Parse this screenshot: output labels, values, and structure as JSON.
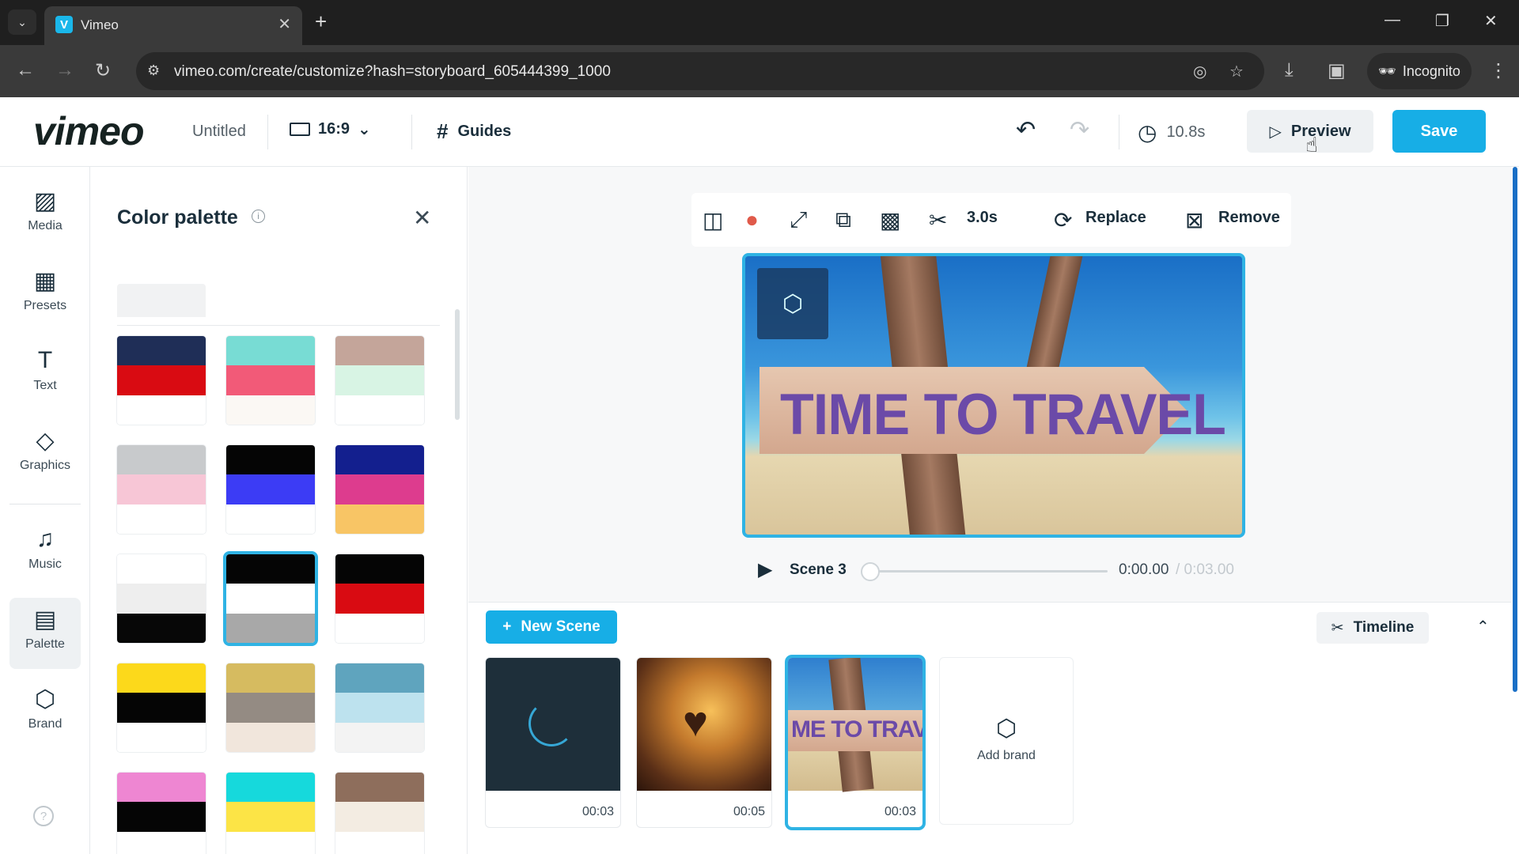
{
  "browser": {
    "tab_title": "Vimeo",
    "tab_favicon": "V",
    "url": "vimeo.com/create/customize?hash=storyboard_605444399_1000",
    "incognito_label": "Incognito"
  },
  "header": {
    "logo": "vimeo",
    "project_title": "Untitled",
    "aspect_ratio": "16:9",
    "guides_label": "Guides",
    "duration": "10.8s",
    "preview_label": "Preview",
    "save_label": "Save"
  },
  "rail": {
    "items": [
      {
        "label": "Media",
        "icon": "image-icon"
      },
      {
        "label": "Presets",
        "icon": "grid-icon"
      },
      {
        "label": "Text",
        "icon": "text-icon"
      },
      {
        "label": "Graphics",
        "icon": "shapes-icon"
      },
      {
        "label": "Music",
        "icon": "music-icon"
      },
      {
        "label": "Palette",
        "icon": "palette-icon"
      },
      {
        "label": "Brand",
        "icon": "brand-icon"
      }
    ],
    "active": "Palette"
  },
  "palette_panel": {
    "title": "Color palette",
    "palettes": [
      {
        "colors": [
          "#1f2e57",
          "#d90b12",
          "#ffffff"
        ]
      },
      {
        "colors": [
          "#78dcd4",
          "#f25a78",
          "#fbf8f4"
        ]
      },
      {
        "colors": [
          "#c4a59a",
          "#d8f4e4",
          "#ffffff"
        ]
      },
      {
        "colors": [
          "#c8cacc",
          "#f7c6d6",
          "#ffffff"
        ]
      },
      {
        "colors": [
          "#050505",
          "#3c3cf5",
          "#ffffff"
        ]
      },
      {
        "colors": [
          "#131f8e",
          "#dd3c8e",
          "#f8c565"
        ]
      },
      {
        "colors": [
          "#ffffff",
          "#eeeeee",
          "#070707"
        ]
      },
      {
        "colors": [
          "#050505",
          "#ffffff",
          "#a8a8a8"
        ],
        "selected": true
      },
      {
        "colors": [
          "#050505",
          "#d90b12",
          "#ffffff"
        ]
      },
      {
        "colors": [
          "#fcd91b",
          "#050505",
          "#ffffff"
        ]
      },
      {
        "colors": [
          "#d6bb60",
          "#948b83",
          "#f1e6dc"
        ]
      },
      {
        "colors": [
          "#5fa4be",
          "#bde2ee",
          "#f3f3f3"
        ]
      },
      {
        "colors": [
          "#ee86d2",
          "#050505",
          "#ffffff"
        ]
      },
      {
        "colors": [
          "#16d9dc",
          "#fce446",
          "#ffffff"
        ]
      },
      {
        "colors": [
          "#8e6e5c",
          "#f3ece2",
          "#ffffff"
        ]
      }
    ]
  },
  "toolbar": {
    "trim_duration": "3.0s",
    "replace_label": "Replace",
    "remove_label": "Remove"
  },
  "stage": {
    "overlay_text": "TIME TO TRAVEL"
  },
  "player": {
    "scene_label": "Scene 3",
    "current_time": "0:00.00",
    "total_time": "/ 0:03.00",
    "progress": 0
  },
  "storyboard": {
    "new_scene_label": "New Scene",
    "timeline_label": "Timeline",
    "scenes": [
      {
        "duration": "00:03"
      },
      {
        "duration": "00:05"
      },
      {
        "duration": "00:03",
        "thumb_text": "ME TO TRAVEL",
        "selected": true
      }
    ],
    "add_brand_label": "Add brand"
  },
  "colors": {
    "accent": "#17aee6",
    "selection": "#2fb3e4",
    "text": "#1a2e3b"
  }
}
